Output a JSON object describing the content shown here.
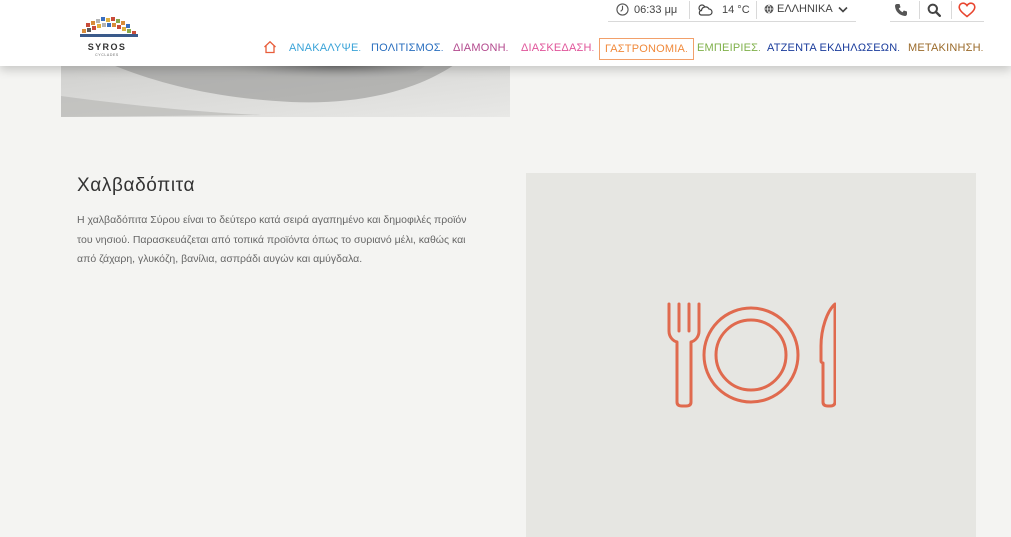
{
  "brand": {
    "name": "SYROS",
    "tagline": "CYCLADES"
  },
  "topbar": {
    "time": "06:33 μμ",
    "temperature": "14 °C",
    "language": "ΕΛΛΗΝΙΚΑ"
  },
  "nav": {
    "items": [
      {
        "label": "ΑΝΑΚΑΛΥΨΕ",
        "color": "#3aa3d8"
      },
      {
        "label": "ΠΟΛΙΤΙΣΜΟΣ",
        "color": "#2a6fbf"
      },
      {
        "label": "ΔΙΑΜΟΝΗ",
        "color": "#b34a8e"
      },
      {
        "label": "ΔΙΑΣΚΕΔΑΣΗ",
        "color": "#e0559a"
      },
      {
        "label": "ΓΑΣΤΡΟΝΟΜΙΑ",
        "color": "#f08a3c",
        "active": true
      },
      {
        "label": "ΕΜΠΕΙΡΙΕΣ",
        "color": "#7fb04a"
      },
      {
        "label": "ΑΤΖΕΝΤΑ ΕΚΔΗΛΩΣΕΩΝ",
        "color": "#1b3d9c"
      },
      {
        "label": "ΜΕΤΑΚΙΝΗΣΗ",
        "color": "#9a6a2a"
      }
    ],
    "dot": "."
  },
  "article": {
    "title": "Χαλβαδόπιτα",
    "body_lines": [
      "Η χαλβαδόπιτα Σύρου είναι το δεύτερο κατά σειρά αγαπημένο και δημοφιλές προϊόν",
      "του νησιού. Παρασκευάζεται από τοπικά προϊόντα όπως το συριανό μέλι, καθώς και",
      "από ζάχαρη, γλυκόζη, βανίλια, ασπράδι αυγών και αμύγδαλα."
    ]
  },
  "colors": {
    "accent": "#e06a4e",
    "heart": "#e8452f",
    "home": "#e85d3a"
  },
  "icons": [
    "clock-icon",
    "weather-cloud-sun-icon",
    "globe-icon",
    "chevron-down-icon",
    "phone-icon",
    "search-icon",
    "heart-icon",
    "home-icon",
    "fork-knife-plate-icon"
  ]
}
